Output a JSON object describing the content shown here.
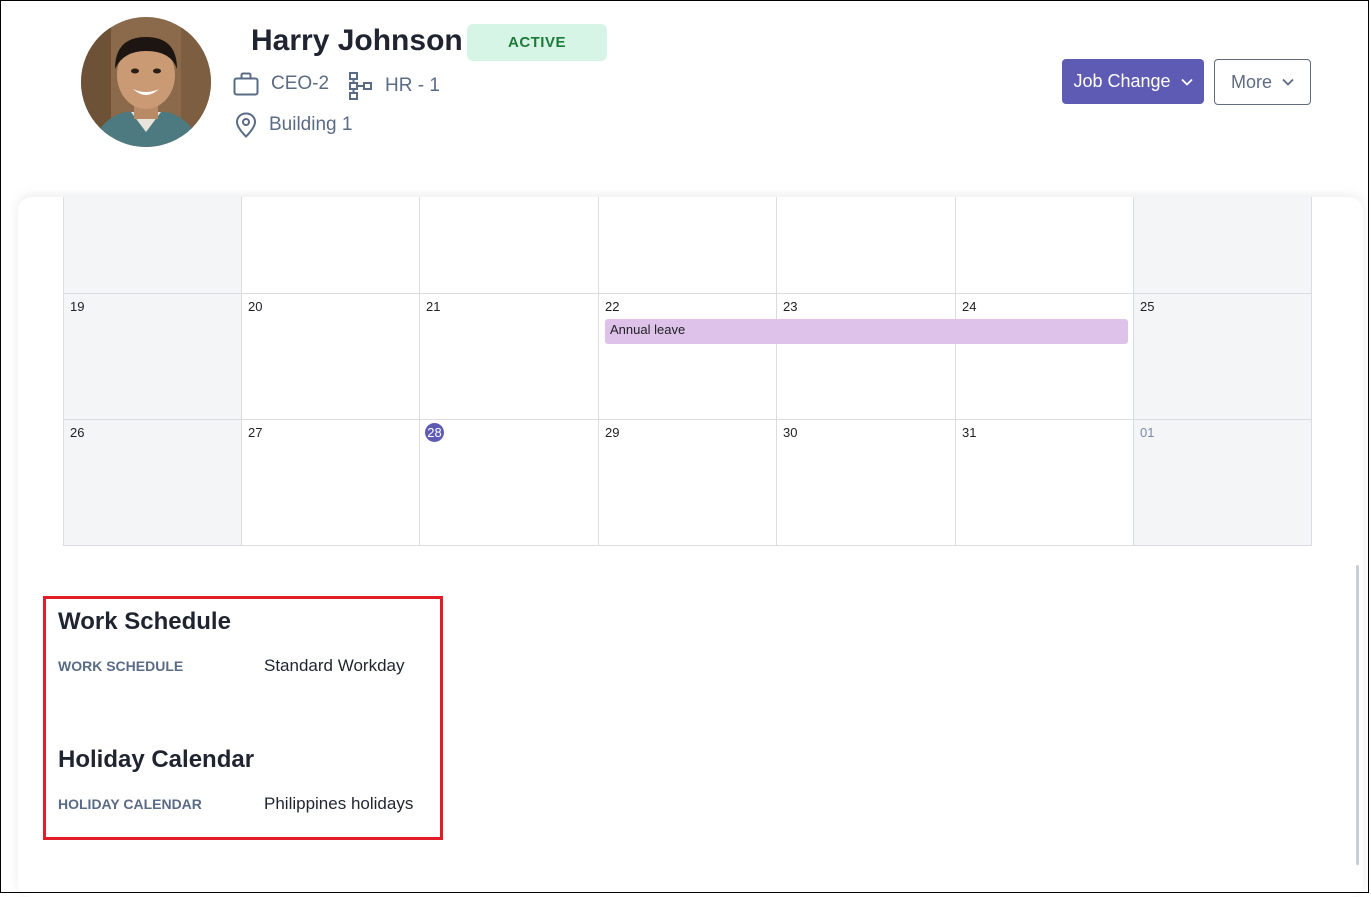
{
  "profile": {
    "name": "Harry Johnson",
    "status": "ACTIVE",
    "position": "CEO-2",
    "department": "HR - 1",
    "location": "Building 1",
    "avatar_icon": "person-photo"
  },
  "actions": {
    "job_change_label": "Job Change",
    "more_label": "More"
  },
  "colors": {
    "accent": "#5e5bb5",
    "status_bg": "#d6f5e6",
    "status_text": "#1f7a3a",
    "event_bg": "#dec2e9",
    "highlight_border": "#e21d2a"
  },
  "calendar": {
    "week2": [
      "19",
      "20",
      "21",
      "22",
      "23",
      "24",
      "25"
    ],
    "week3": [
      "26",
      "27",
      "28",
      "29",
      "30",
      "31",
      "01"
    ],
    "today": "28",
    "event": {
      "label": "Annual leave"
    }
  },
  "work_schedule": {
    "title": "Work Schedule",
    "label": "WORK SCHEDULE",
    "value": "Standard Workday"
  },
  "holiday_calendar": {
    "title": "Holiday Calendar",
    "label": "HOLIDAY CALENDAR",
    "value": "Philippines holidays"
  }
}
